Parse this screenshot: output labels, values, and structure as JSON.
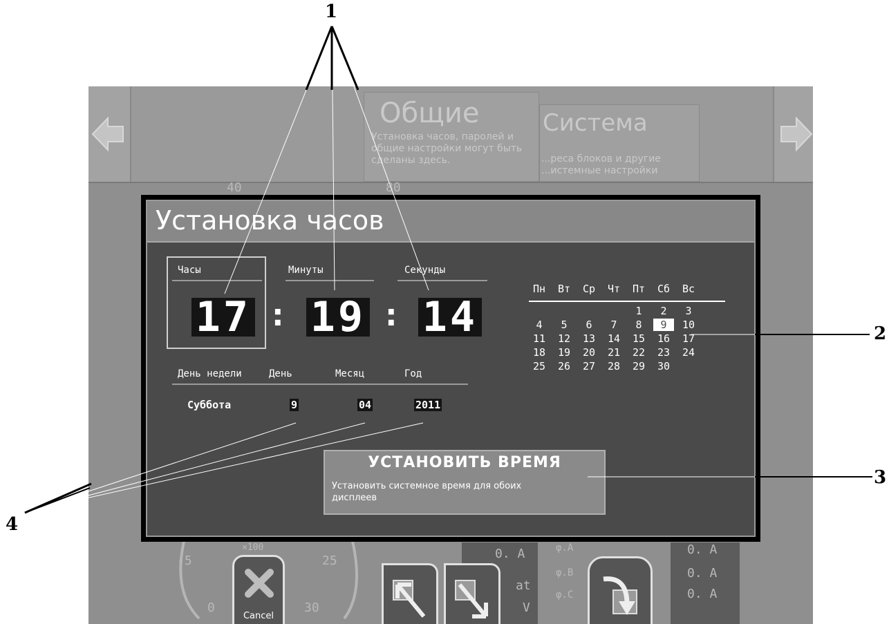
{
  "background": {
    "tabs": [
      {
        "title": "Общие",
        "description": "Установка часов, паролей и общие настройки могут быть сделаны здесь."
      },
      {
        "title": "Система",
        "description": "...реса блоков и другие ...истемные настройки"
      }
    ],
    "gauge_labels": [
      "40",
      "80",
      "-5",
      "25",
      "0",
      "30",
      "×100"
    ],
    "readouts": [
      "0. A",
      "0. A",
      "0. A",
      "0. A"
    ],
    "phase_labels": [
      "φ.A",
      "φ.B",
      "φ.C"
    ],
    "misc": [
      "at",
      "V"
    ],
    "cancel_label": "Cancel"
  },
  "dialog": {
    "title": "Установка часов",
    "time": {
      "hours_label": "Часы",
      "minutes_label": "Минуты",
      "seconds_label": "Секунды",
      "hours": "17",
      "minutes": "19",
      "seconds": "14",
      "separator": ":"
    },
    "date": {
      "weekday_label": "День недели",
      "day_label": "День",
      "month_label": "Месяц",
      "year_label": "Год",
      "weekday": "Суббота",
      "day": "9",
      "month": "04",
      "year": "2011"
    },
    "calendar": {
      "weekdays": [
        "Пн",
        "Вт",
        "Ср",
        "Чт",
        "Пт",
        "Сб",
        "Вс"
      ],
      "weeks": [
        [
          "",
          "",
          "",
          "",
          "1",
          "2",
          "3"
        ],
        [
          "4",
          "5",
          "6",
          "7",
          "8",
          "9",
          "10"
        ],
        [
          "11",
          "12",
          "13",
          "14",
          "15",
          "16",
          "17"
        ],
        [
          "18",
          "19",
          "20",
          "21",
          "22",
          "23",
          "24"
        ],
        [
          "25",
          "26",
          "27",
          "28",
          "29",
          "30",
          ""
        ]
      ],
      "selected": "9"
    },
    "set_button": {
      "title": "УСТАНОВИТЬ ВРЕМЯ",
      "description": "Установить системное время для обоих дисплеев"
    }
  },
  "callouts": [
    "1",
    "2",
    "3",
    "4"
  ]
}
